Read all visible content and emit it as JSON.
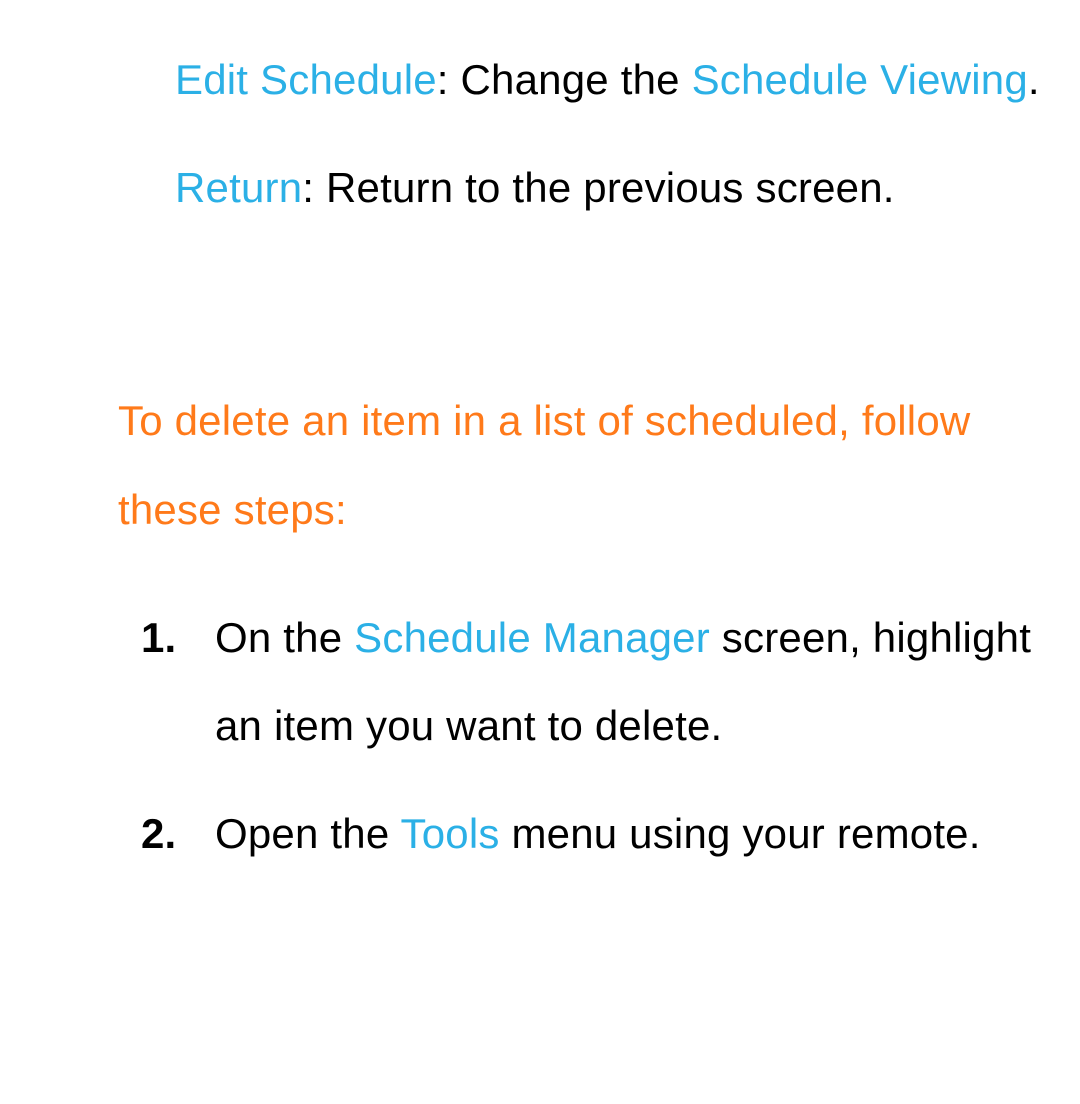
{
  "definitions": [
    {
      "term": "Edit Schedule",
      "body_pre": ": Change the ",
      "link": "Schedule Viewing",
      "body_post": "."
    },
    {
      "term": "Return",
      "body_pre": ": Return to the previous screen.",
      "link": "",
      "body_post": ""
    }
  ],
  "heading": "To delete an item in a list of scheduled, follow these steps:",
  "steps": [
    {
      "num": "1.",
      "pre": "On the ",
      "link": "Schedule Manager",
      "post": " screen, highlight an item you want to delete."
    },
    {
      "num": "2.",
      "pre": "Open the ",
      "link": "Tools",
      "post": " menu using your remote."
    }
  ]
}
